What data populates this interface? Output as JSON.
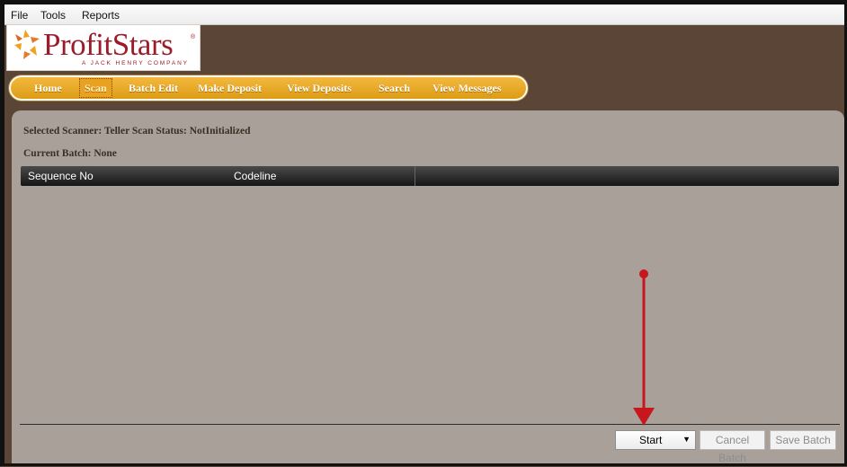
{
  "menu": {
    "file": "File",
    "tools": "Tools",
    "reports": "Reports"
  },
  "logo": {
    "name": "ProfitStars",
    "registered": "®",
    "tagline": "A JACK HENRY COMPANY"
  },
  "nav": {
    "home": "Home",
    "scan": "Scan",
    "batch_edit": "Batch Edit",
    "make_deposit": "Make Deposit",
    "view_deposits": "View Deposits",
    "search": "Search",
    "view_messages": "View Messages",
    "active": "Scan"
  },
  "scan_panel": {
    "scanner_line": "Selected Scanner: Teller Scan  Status: NotInitialized",
    "batch_line": "Current Batch: None",
    "columns": [
      "Sequence No",
      "Codeline"
    ],
    "rows": []
  },
  "actions": {
    "start_select_value": "Start",
    "cancel_batch": "Cancel Batch",
    "save_batch": "Save Batch"
  },
  "colors": {
    "background": "#5a4536",
    "nav": "#e5a52a",
    "panel": "#a9a09a",
    "annotation_arrow": "#c8161d"
  }
}
